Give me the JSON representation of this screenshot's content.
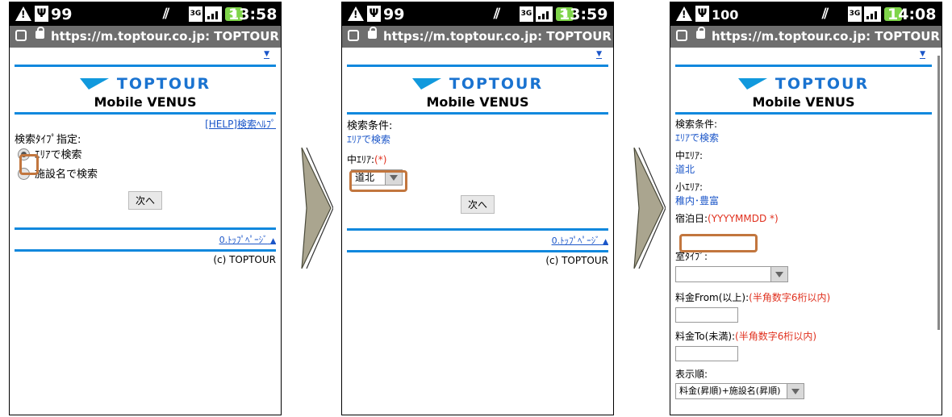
{
  "url_text": "https://m.toptour.co.jp: TOPTOUR",
  "logo_text": "TOPTOUR",
  "app_title": "Mobile VENUS",
  "icons": [
    "warning-icon",
    "usb-icon",
    "vibrate-icon",
    "3g-icon",
    "signal-icon",
    "battery-icon",
    "secure-lock-icon",
    "browser-icon"
  ],
  "colors": {
    "accent_blue": "#1188dd",
    "link_blue": "#1a55c8",
    "required_red": "#e0301e",
    "highlight": "#c2763e"
  },
  "screens": [
    {
      "status": {
        "battery": "99",
        "time": "13:58"
      },
      "help_link": "[HELP]検索ﾍﾙﾌﾟ",
      "search_type_label": "検索ﾀｲﾌﾟ指定:",
      "option_area": "ｴﾘｱで検索",
      "option_facility": "施設名で検索",
      "next_button": "次へ",
      "top_page_link": "0.ﾄｯﾌﾟﾍﾟｰｼﾞ",
      "copyright": "(c) TOPTOUR"
    },
    {
      "status": {
        "battery": "99",
        "time": "13:59"
      },
      "conditions_label": "検索条件:",
      "conditions_value": "ｴﾘｱで検索",
      "mid_area_label": "中ｴﾘｱ:",
      "required_mark": "(*)",
      "mid_area_selected": "道北",
      "next_button": "次へ",
      "top_page_link": "0.ﾄｯﾌﾟﾍﾟｰｼﾞ",
      "copyright": "(c) TOPTOUR"
    },
    {
      "status": {
        "battery": "100",
        "time": "14:08"
      },
      "conditions_label": "検索条件:",
      "conditions_value": "ｴﾘｱで検索",
      "mid_area_label": "中ｴﾘｱ:",
      "mid_area_value": "道北",
      "small_area_label": "小ｴﾘｱ:",
      "small_area_value": "稚内･豊富",
      "stay_date_label": "宿泊日:",
      "stay_date_hint": "(YYYYMMDD *)",
      "room_type_label": "室ﾀｲﾌﾟ:",
      "room_type_selected": "",
      "price_from_label": "料金From(以上):",
      "price_from_hint": "(半角数字6桁以内)",
      "price_to_label": "料金To(未満):",
      "price_to_hint": "(半角数字6桁以内)",
      "sort_label": "表示順:",
      "sort_selected": "料金(昇順)+施設名(昇順)"
    }
  ]
}
